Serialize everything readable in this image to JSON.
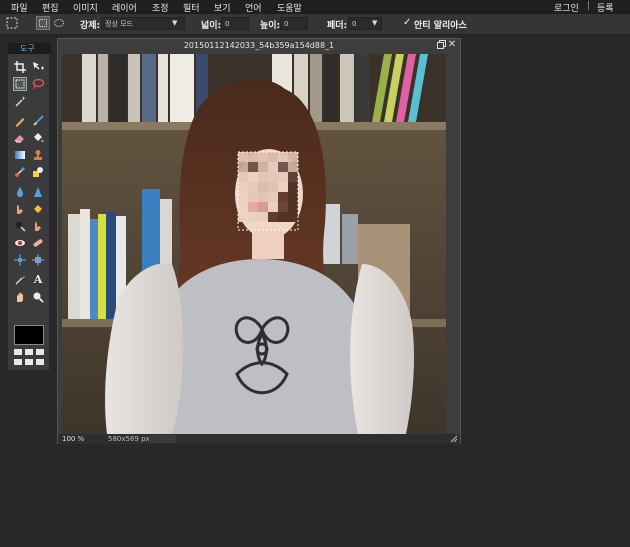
{
  "menu": {
    "items": [
      "파일",
      "편집",
      "이미지",
      "레이어",
      "조정",
      "필터",
      "보기",
      "언어",
      "도움말"
    ],
    "login": "로그인",
    "separator": "|",
    "register": "등록"
  },
  "options": {
    "style_label": "강제:",
    "style_value": "정상 모드",
    "width_label": "넓이:",
    "width_value": "0",
    "height_label": "높이:",
    "height_value": "0",
    "feather_label": "페더:",
    "feather_value": "0",
    "antialias_check": "✓",
    "antialias_label": "안티 알리아스"
  },
  "toolbox": {
    "title": "도구",
    "text_tool": "A"
  },
  "document": {
    "title": "20150112142033_54b359a154d88_1",
    "zoom": "100",
    "zoom_unit": "%",
    "size": "580x569 px"
  },
  "colors": {
    "accent": "#6fb0e6",
    "panel": "#3b3b3b",
    "background": "#282828"
  }
}
